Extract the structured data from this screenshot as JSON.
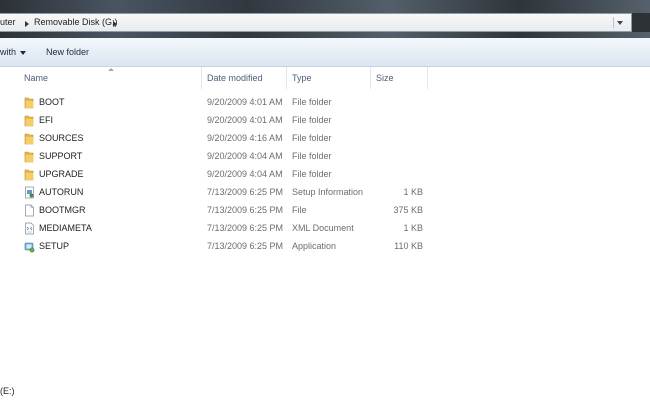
{
  "address": {
    "crumbs": [
      "uter",
      "Removable Disk (G:)"
    ]
  },
  "toolbar": {
    "share_label": "with",
    "new_folder_label": "New folder"
  },
  "columns": {
    "name": "Name",
    "date": "Date modified",
    "type": "Type",
    "size": "Size"
  },
  "files": [
    {
      "name": "BOOT",
      "date": "9/20/2009 4:01 AM",
      "type": "File folder",
      "size": "",
      "icon": "folder-icon"
    },
    {
      "name": "EFI",
      "date": "9/20/2009 4:01 AM",
      "type": "File folder",
      "size": "",
      "icon": "folder-icon"
    },
    {
      "name": "SOURCES",
      "date": "9/20/2009 4:16 AM",
      "type": "File folder",
      "size": "",
      "icon": "folder-icon"
    },
    {
      "name": "SUPPORT",
      "date": "9/20/2009 4:04 AM",
      "type": "File folder",
      "size": "",
      "icon": "folder-icon"
    },
    {
      "name": "UPGRADE",
      "date": "9/20/2009 4:04 AM",
      "type": "File folder",
      "size": "",
      "icon": "folder-icon"
    },
    {
      "name": "AUTORUN",
      "date": "7/13/2009 6:25 PM",
      "type": "Setup Information",
      "size": "1 KB",
      "icon": "setup-info-icon"
    },
    {
      "name": "BOOTMGR",
      "date": "7/13/2009 6:25 PM",
      "type": "File",
      "size": "375 KB",
      "icon": "file-icon"
    },
    {
      "name": "MEDIAMETA",
      "date": "7/13/2009 6:25 PM",
      "type": "XML Document",
      "size": "1 KB",
      "icon": "xml-document-icon"
    },
    {
      "name": "SETUP",
      "date": "7/13/2009 6:25 PM",
      "type": "Application",
      "size": "110 KB",
      "icon": "setup-application-icon"
    }
  ],
  "status": {
    "text": "(E:)"
  }
}
